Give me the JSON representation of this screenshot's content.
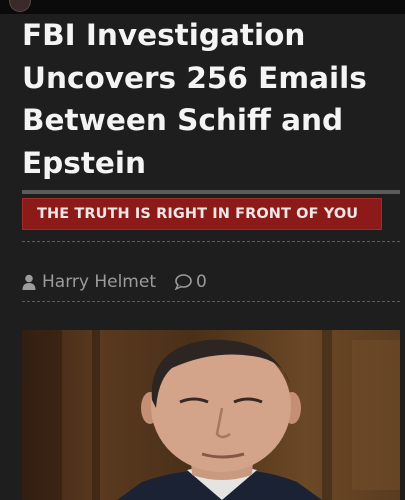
{
  "article": {
    "headline": "FBI Investigation Uncovers 256 Emails Between Schiff and Epstein",
    "banner": "THE TRUTH IS RIGHT IN FRONT OF YOU",
    "author": "Harry Helmet",
    "comment_count": "0"
  },
  "icons": {
    "author": "user-icon",
    "comments": "comment-bubble-icon"
  },
  "colors": {
    "background": "#1e1e1f",
    "banner": "#8c1a19",
    "headline": "#f4f4f4",
    "meta": "#9c9c9c"
  }
}
